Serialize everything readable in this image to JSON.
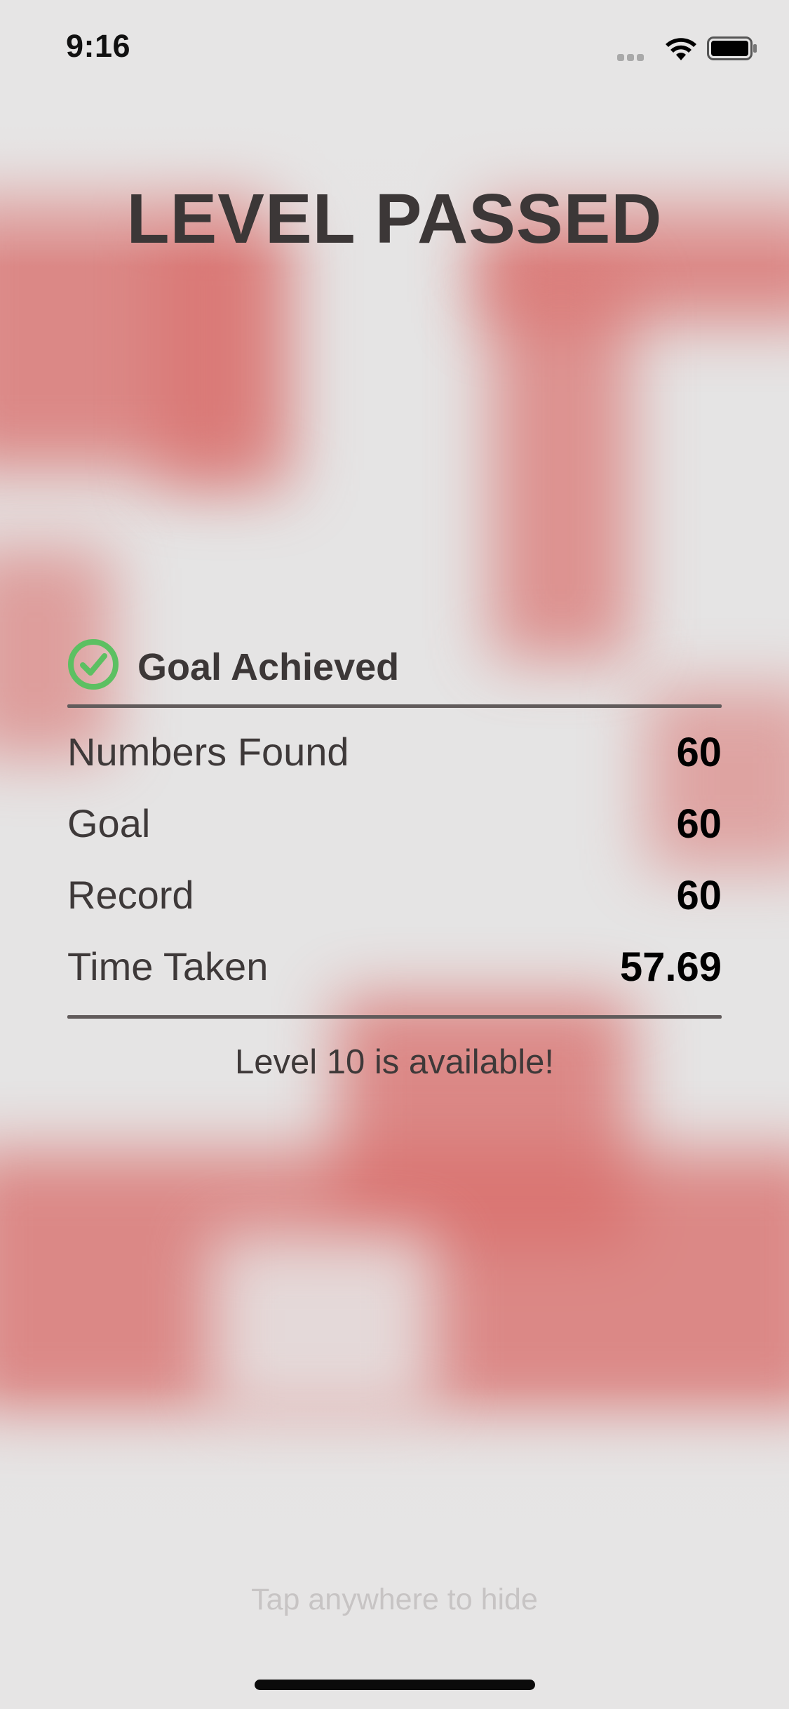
{
  "status_bar": {
    "time": "9:16",
    "icons": [
      "cellular-signal-icon",
      "wifi-icon",
      "battery-icon"
    ]
  },
  "title": "LEVEL PASSED",
  "result": {
    "status_icon": "checkmark-circle-icon",
    "status_label": "Goal Achieved",
    "stats": [
      {
        "label": "Numbers Found",
        "value": "60"
      },
      {
        "label": "Goal",
        "value": "60"
      },
      {
        "label": "Record",
        "value": "60"
      },
      {
        "label": "Time Taken",
        "value": "57.69"
      }
    ],
    "message": "Level 10 is available!"
  },
  "hint": "Tap anywhere to hide",
  "colors": {
    "accent_green": "#5cc062",
    "backdrop_red": "#d96f6c",
    "background": "#e5e4e4",
    "title_text": "#3c3737"
  }
}
